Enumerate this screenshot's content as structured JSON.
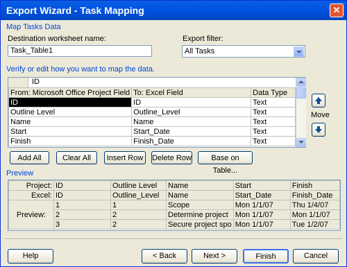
{
  "window": {
    "title": "Export Wizard - Task Mapping",
    "close_glyph": "✕"
  },
  "map_section": {
    "heading": "Map Tasks Data",
    "dest_label": "Destination worksheet name:",
    "dest_value": "Task_Table1",
    "filter_label": "Export filter:",
    "filter_value": "All Tasks"
  },
  "mapping": {
    "heading": "Verify or edit how you want to map the data.",
    "edit_value": "ID",
    "columns": [
      "From: Microsoft Office Project Field",
      "To:  Excel Field",
      "Data Type"
    ],
    "rows": [
      [
        "ID",
        "ID",
        "Text"
      ],
      [
        "Outline Level",
        "Outline_Level",
        "Text"
      ],
      [
        "Name",
        "Name",
        "Text"
      ],
      [
        "Start",
        "Start_Date",
        "Text"
      ],
      [
        "Finish",
        "Finish_Date",
        "Text"
      ]
    ],
    "move_label": "Move"
  },
  "buttons": {
    "add_all": "Add All",
    "clear_all": "Clear All",
    "insert_row": "Insert Row",
    "delete_row": "Delete Row",
    "base_on_table": "Base on Table..."
  },
  "preview": {
    "heading": "Preview",
    "project_label": "Project:",
    "excel_label": "Excel:",
    "preview_label": "Preview:",
    "project_row": [
      "ID",
      "Outline Level",
      "Name",
      "Start",
      "Finish"
    ],
    "excel_row": [
      "ID",
      "Outline_Level",
      "Name",
      "Start_Date",
      "Finish_Date"
    ],
    "rows": [
      [
        "1",
        "1",
        "Scope",
        "Mon 1/1/07",
        "Thu 1/4/07"
      ],
      [
        "2",
        "2",
        "Determine project",
        "Mon 1/1/07",
        "Mon 1/1/07"
      ],
      [
        "3",
        "2",
        "Secure project spo",
        "Mon 1/1/07",
        "Tue 1/2/07"
      ]
    ]
  },
  "footer": {
    "help": "Help",
    "back": "< Back",
    "next": "Next >",
    "finish": "Finish",
    "cancel": "Cancel"
  }
}
